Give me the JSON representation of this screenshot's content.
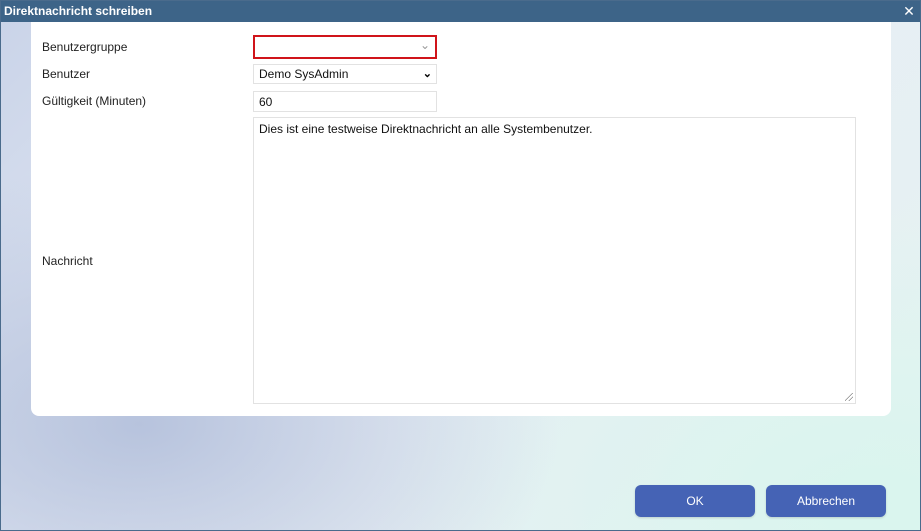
{
  "window": {
    "title": "Direktnachricht schreiben",
    "close_symbol": "✕"
  },
  "form": {
    "user_group_label": "Benutzergruppe",
    "user_group_value": "",
    "user_label": "Benutzer",
    "user_value": "Demo SysAdmin",
    "validity_label": "Gültigkeit (Minuten)",
    "validity_value": "60",
    "message_label": "Nachricht",
    "message_value": "Dies ist eine testweise Direktnachricht an alle Systembenutzer."
  },
  "buttons": {
    "ok_label": "OK",
    "cancel_label": "Abbrechen"
  },
  "colors": {
    "titlebar": "#3d6488",
    "button": "#4563b5",
    "error_border": "#d0141a"
  },
  "icons": {
    "close": "close-icon",
    "dropdown": "chevron-down-icon",
    "resize": "resize-grip-icon"
  }
}
